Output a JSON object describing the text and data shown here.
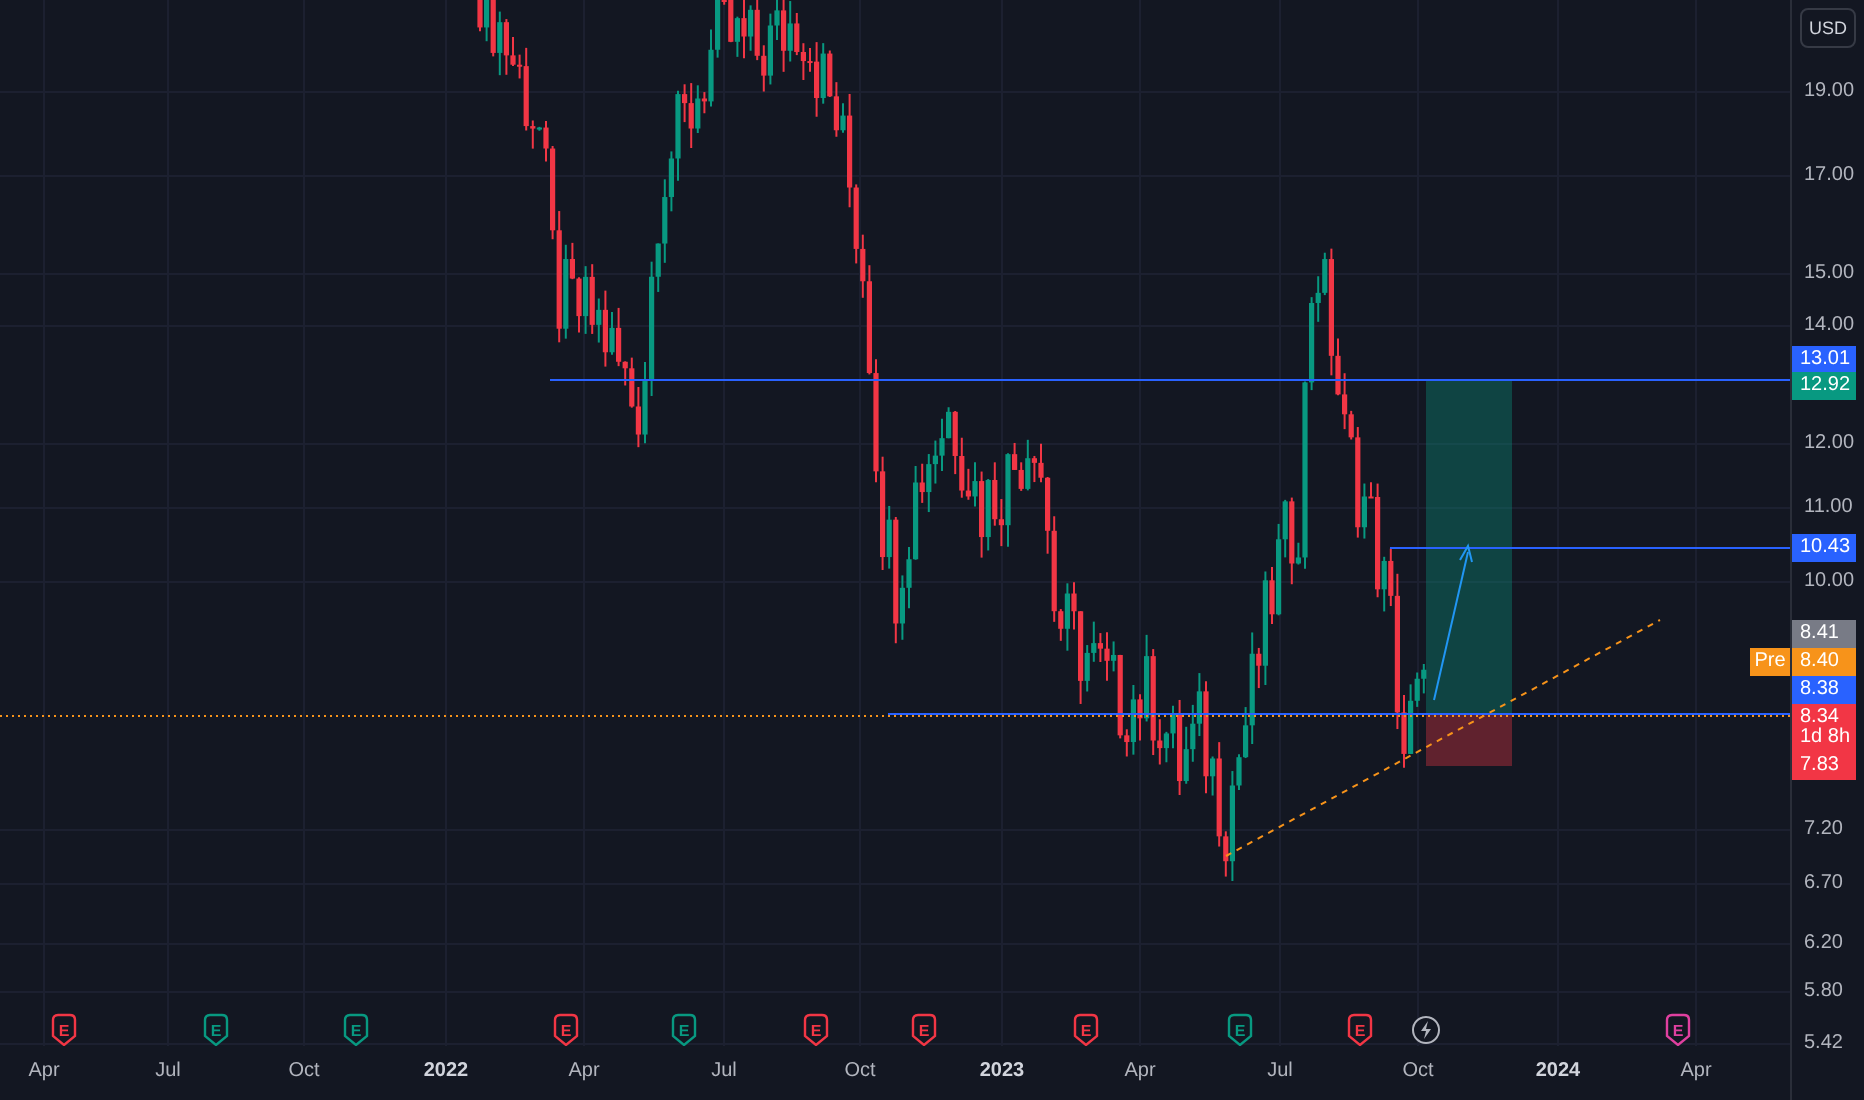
{
  "price_axis": {
    "currency": "USD",
    "ticks": [
      "19.00",
      "17.00",
      "15.00",
      "14.00",
      "12.00",
      "11.00",
      "10.00",
      "7.20",
      "6.70",
      "6.20",
      "5.80",
      "5.42"
    ]
  },
  "price_tags": [
    {
      "label": "13.01",
      "color": "#2962ff"
    },
    {
      "label": "12.92",
      "color": "#089981"
    },
    {
      "label": "10.43",
      "color": "#2962ff"
    },
    {
      "label": "8.41",
      "color": "#787b86"
    },
    {
      "label": "8.40",
      "color": "#f7931a",
      "prefix": "Pre"
    },
    {
      "label": "8.38",
      "color": "#2962ff"
    },
    {
      "label": "8.34",
      "color": "#f23645"
    },
    {
      "label": "1d 8h",
      "color": "#f23645"
    },
    {
      "label": "7.83",
      "color": "#f23645"
    }
  ],
  "events": [
    {
      "kind": "earnings",
      "text": "E",
      "color": "#f23645"
    },
    {
      "kind": "earnings",
      "text": "E",
      "color": "#089981"
    },
    {
      "kind": "earnings",
      "text": "E",
      "color": "#089981"
    },
    {
      "kind": "earnings",
      "text": "E",
      "color": "#f23645"
    },
    {
      "kind": "earnings",
      "text": "E",
      "color": "#089981"
    },
    {
      "kind": "earnings",
      "text": "E",
      "color": "#f23645"
    },
    {
      "kind": "earnings",
      "text": "E",
      "color": "#f23645"
    },
    {
      "kind": "earnings",
      "text": "E",
      "color": "#f23645"
    },
    {
      "kind": "earnings",
      "text": "E",
      "color": "#089981"
    },
    {
      "kind": "earnings",
      "text": "E",
      "color": "#f23645"
    },
    {
      "kind": "split",
      "color": "#b2b5be"
    },
    {
      "kind": "earnings",
      "text": "E",
      "color": "#e040a0"
    }
  ],
  "time_axis": [
    {
      "label": "Apr",
      "bold": false
    },
    {
      "label": "Jul",
      "bold": false
    },
    {
      "label": "Oct",
      "bold": false
    },
    {
      "label": "2022",
      "bold": true
    },
    {
      "label": "Apr",
      "bold": false
    },
    {
      "label": "Jul",
      "bold": false
    },
    {
      "label": "Oct",
      "bold": false
    },
    {
      "label": "2023",
      "bold": true
    },
    {
      "label": "Apr",
      "bold": false
    },
    {
      "label": "Jul",
      "bold": false
    },
    {
      "label": "Oct",
      "bold": false
    },
    {
      "label": "2024",
      "bold": true
    },
    {
      "label": "Apr",
      "bold": false
    }
  ]
}
